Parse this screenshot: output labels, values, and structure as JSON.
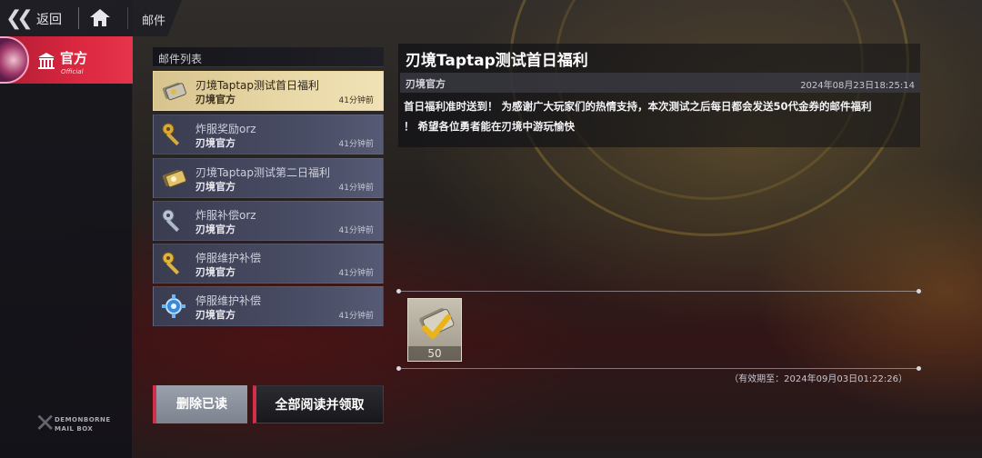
{
  "topbar": {
    "back_label": "返回",
    "page_title": "邮件",
    "icons": [
      "double-chevron-left-icon",
      "home-icon"
    ]
  },
  "sidebar": {
    "active_tab": {
      "label": "官方",
      "sublabel": "Official",
      "icon": "temple-icon"
    },
    "logo": {
      "line1": "DEMONBORNE",
      "line2": "MAIL BOX"
    }
  },
  "mail_list": {
    "header": "邮件列表",
    "items": [
      {
        "title": "刃境Taptap测试首日福利",
        "sender": "刃境官方",
        "time": "41分钟前",
        "selected": true,
        "icon": "golden-ticket-icon"
      },
      {
        "title": "炸服奖励orz",
        "sender": "刃境官方",
        "time": "41分钟前",
        "selected": false,
        "icon": "golden-key-icon"
      },
      {
        "title": "刃境Taptap测试第二日福利",
        "sender": "刃境官方",
        "time": "41分钟前",
        "selected": false,
        "icon": "golden-ticket-icon"
      },
      {
        "title": "炸服补偿orz",
        "sender": "刃境官方",
        "time": "41分钟前",
        "selected": false,
        "icon": "silver-key-icon"
      },
      {
        "title": "停服维护补偿",
        "sender": "刃境官方",
        "time": "41分钟前",
        "selected": false,
        "icon": "golden-key-icon"
      },
      {
        "title": "停服维护补偿",
        "sender": "刃境官方",
        "time": "41分钟前",
        "selected": false,
        "icon": "blue-gear-icon"
      }
    ]
  },
  "buttons": {
    "delete_read": "删除已读",
    "read_all_claim": "全部阅读并领取"
  },
  "detail": {
    "title": "刃境Taptap测试首日福利",
    "sender": "刃境官方",
    "date": "2024年08月23日18:25:14",
    "body_line1": "首日福利准时送到！ 为感谢广大玩家们的热情支持，本次测试之后每日都会发送50代金券的邮件福利",
    "body_line2": "！ 希望各位勇者能在刃境中游玩愉快",
    "reward": {
      "count": "50",
      "icon": "voucher-ticket-icon",
      "claimed": true
    },
    "expiry": "（有效期至：2024年09月03日01:22:26）"
  },
  "colors": {
    "accent_red": "#dc2840",
    "selected_mail": "#ead9a8",
    "mail_item": "#4a4e66"
  }
}
